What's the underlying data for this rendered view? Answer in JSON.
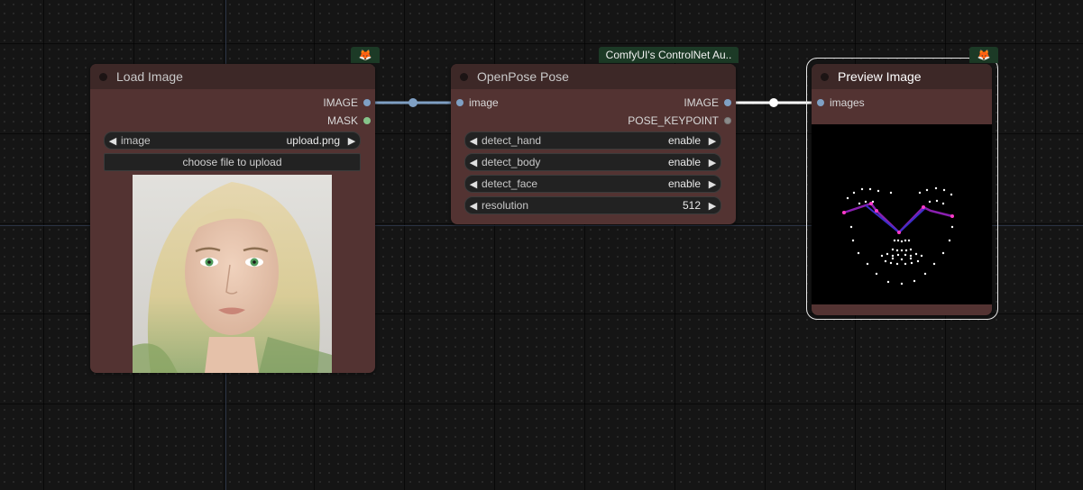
{
  "nodes": {
    "load_image": {
      "title": "Load Image",
      "outputs": [
        "IMAGE",
        "MASK"
      ],
      "widget_image": {
        "label": "image",
        "value": "upload.png"
      },
      "upload_button": "choose file to upload",
      "badge_icon": "fox-icon"
    },
    "openpose": {
      "title": "OpenPose Pose",
      "badge": "ComfyUI's ControlNet Au..",
      "input": "image",
      "outputs": [
        "IMAGE",
        "POSE_KEYPOINT"
      ],
      "widgets": [
        {
          "label": "detect_hand",
          "value": "enable"
        },
        {
          "label": "detect_body",
          "value": "enable"
        },
        {
          "label": "detect_face",
          "value": "enable"
        },
        {
          "label": "resolution",
          "value": "512"
        }
      ]
    },
    "preview": {
      "title": "Preview Image",
      "input": "images",
      "badge_icon": "fox-icon"
    }
  },
  "colors": {
    "node_body": "#533332",
    "node_header": "#3d2827",
    "badge": "#1c3a26",
    "image_link": "#7fa0c4",
    "selected_link": "#ffffff"
  }
}
